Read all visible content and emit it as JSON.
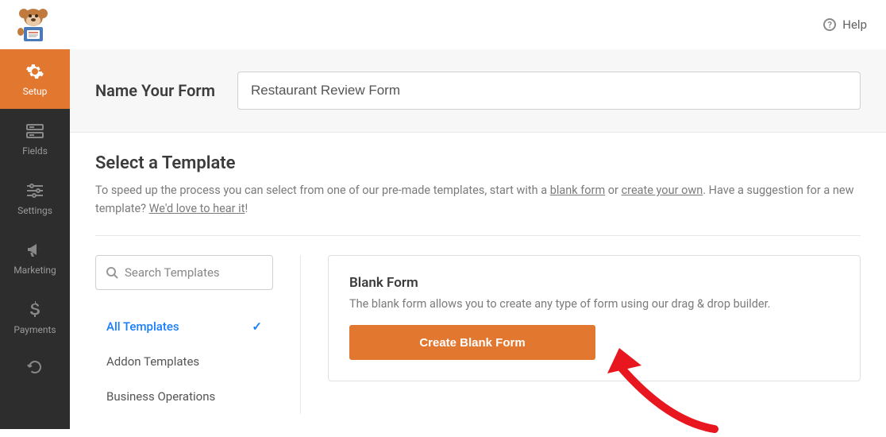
{
  "topbar": {
    "help_label": "Help"
  },
  "sidebar": {
    "items": [
      {
        "label": "Setup"
      },
      {
        "label": "Fields"
      },
      {
        "label": "Settings"
      },
      {
        "label": "Marketing"
      },
      {
        "label": "Payments"
      }
    ]
  },
  "name_section": {
    "label": "Name Your Form",
    "value": "Restaurant Review Form"
  },
  "template_section": {
    "title": "Select a Template",
    "desc_prefix": "To speed up the process you can select from one of our pre-made templates, start with a ",
    "link_blank": "blank form",
    "desc_or": " or ",
    "link_create": "create your own",
    "desc_suffix": ". Have a suggestion for a new template? ",
    "link_hear": "We'd love to hear it",
    "desc_end": "!"
  },
  "search": {
    "placeholder": "Search Templates"
  },
  "categories": [
    {
      "label": "All Templates",
      "active": true
    },
    {
      "label": "Addon Templates",
      "active": false
    },
    {
      "label": "Business Operations",
      "active": false
    }
  ],
  "card": {
    "title": "Blank Form",
    "desc": "The blank form allows you to create any type of form using our drag & drop builder.",
    "button": "Create Blank Form"
  }
}
